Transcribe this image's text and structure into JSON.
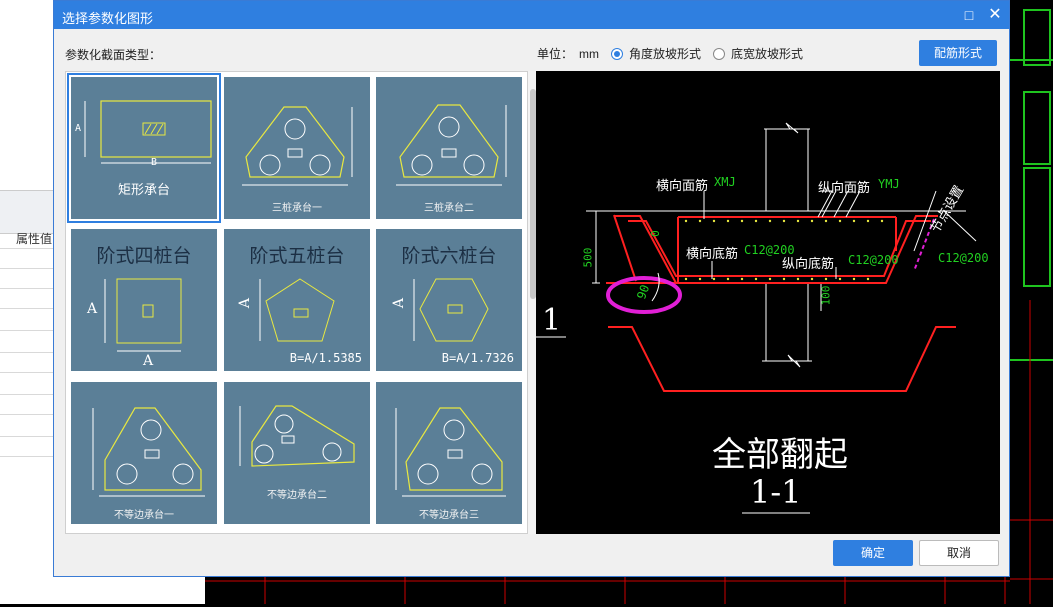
{
  "background": {
    "attr_label": "属性值"
  },
  "dialog": {
    "title": "选择参数化图形",
    "type_label": "参数化截面类型：",
    "unit_label": "单位：",
    "unit_value": "mm",
    "radio_angle": "角度放坡形式",
    "radio_width": "底宽放坡形式",
    "rebar_button": "配筋形式",
    "ok_button": "确定",
    "cancel_button": "取消"
  },
  "thumbnails": [
    {
      "caption": "矩形承台",
      "dim_a": "A",
      "dim_b": "B"
    },
    {
      "caption": "三桩承台一"
    },
    {
      "caption": "三桩承台二"
    },
    {
      "title": "阶式四桩台",
      "dim_a": "A",
      "dim_b": "A"
    },
    {
      "title": "阶式五桩台",
      "dim_a": "A",
      "formula": "B=A/1.5385"
    },
    {
      "title": "阶式六桩台",
      "dim_a": "A",
      "formula": "B=A/1.7326"
    },
    {
      "caption": "不等边承台一"
    },
    {
      "caption": "不等边承台二"
    },
    {
      "caption": "不等边承台三"
    }
  ],
  "preview": {
    "label_h_top": "横向面筋",
    "label_h_top_code": "XMJ",
    "label_v_top": "纵向面筋",
    "label_v_top_code": "YMJ",
    "label_h_bot": "横向底筋",
    "label_h_bot_code": "C12@200",
    "label_v_bot": "纵向底筋",
    "label_v_bot_code": "C12@200",
    "label_right_code": "C12@200",
    "label_node": "节点设置",
    "dim_500": "500",
    "dim_100": "100",
    "dim_0": "0",
    "angle": "90",
    "mark_1": "1",
    "main_title": "全部翻起",
    "section": "1-1"
  },
  "colors": {
    "accent": "#2f7fe0",
    "thumb_bg": "#5b7f97",
    "cad_red": "#ff2020",
    "cad_green": "#21d021",
    "cad_yellow": "#e8e840",
    "highlight": "#e11fd6"
  }
}
